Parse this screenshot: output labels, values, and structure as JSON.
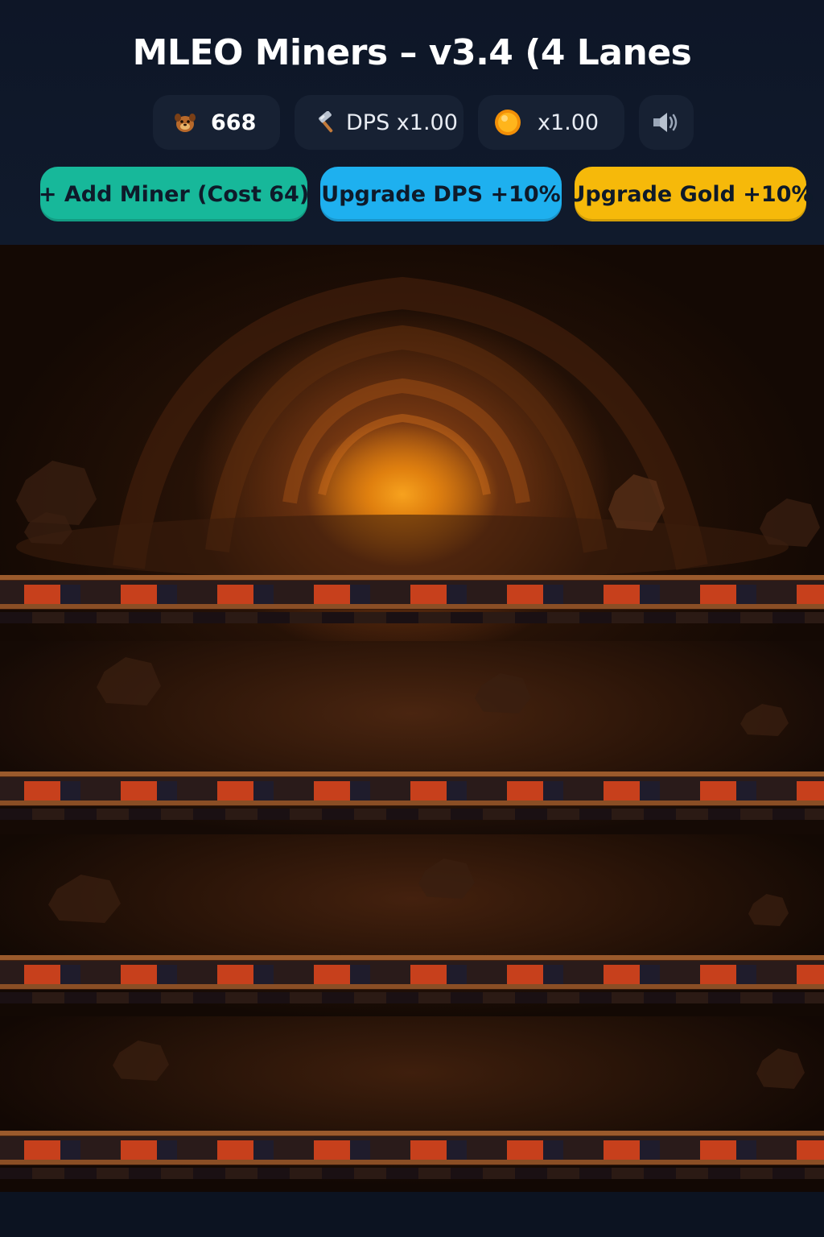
{
  "title": "MLEO Miners – v3.4 (4 Lanes",
  "stats": {
    "coins": {
      "icon": "dog-coin-icon",
      "value": "668"
    },
    "dps": {
      "icon": "hammer-icon",
      "label": "DPS x1.00"
    },
    "gold": {
      "icon": "gold-coin-icon",
      "label": "x1.00"
    },
    "sound": {
      "icon": "speaker-icon"
    }
  },
  "actions": {
    "add_miner": "+ Add Miner (Cost 64)",
    "upgrade_dps": "Upgrade DPS +10%",
    "upgrade_gold": "Upgrade Gold +10%"
  },
  "colors": {
    "background": "#0b1220",
    "stat_pill": "#172133",
    "add_miner_button": "#17b89a",
    "upgrade_dps_button": "#1eb0ef",
    "upgrade_gold_button": "#f6b90a",
    "tunnel_glow": "#f59a1c",
    "rail_tie": "#c7401c"
  },
  "mine": {
    "lanes": 4
  }
}
